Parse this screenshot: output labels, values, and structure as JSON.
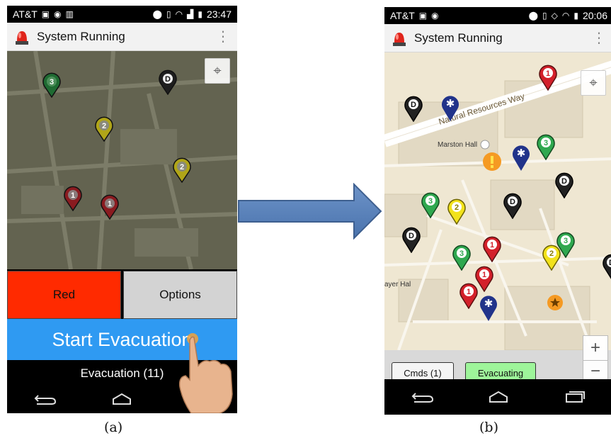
{
  "panel_a": {
    "status": {
      "carrier": "AT&T",
      "time": "23:47"
    },
    "app_title": "System Running",
    "red_button": "Red",
    "options_button": "Options",
    "start_button": "Start Evacuation",
    "evacuation_status": "Evacuation (11)",
    "markers": [
      "3",
      "D",
      "2",
      "2",
      "1",
      "1"
    ],
    "caption": "(a)"
  },
  "panel_b": {
    "status": {
      "carrier": "AT&T",
      "time": "20:06"
    },
    "app_title": "System Running",
    "map_labels": {
      "road": "Natural Resources Way",
      "building": "Marston Hall",
      "left_building": "ayer Hal"
    },
    "cmds_button": "Cmds (1)",
    "evacuating_button": "Evacuating",
    "zoom_in": "+",
    "zoom_out": "−",
    "markers": [
      "1",
      "D",
      "3",
      "D",
      "3",
      "2",
      "D",
      "D",
      "3",
      "1",
      "2",
      "3",
      "1",
      "1",
      "D"
    ],
    "caption": "(b)"
  },
  "colors": {
    "red_marker": "#d3202a",
    "green_marker": "#2fa84f",
    "yellow_marker": "#f2e21b",
    "black_marker": "#333333",
    "evac_blue": "#2f9af2",
    "red_button": "#ff2a00",
    "evacuating_green": "#9ef59a"
  }
}
